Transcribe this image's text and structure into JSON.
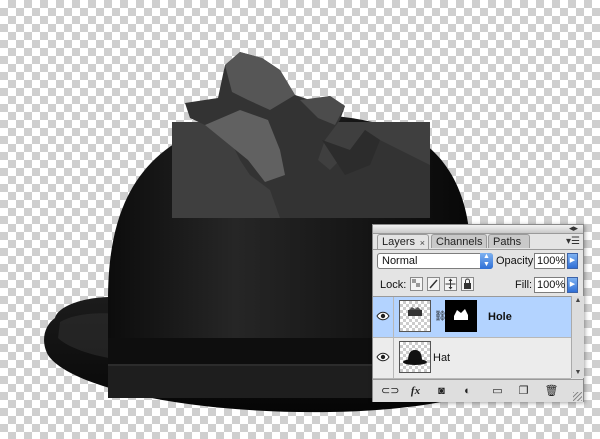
{
  "panel": {
    "tabs": [
      {
        "label": "Layers",
        "active": true
      },
      {
        "label": "Channels",
        "active": false
      },
      {
        "label": "Paths",
        "active": false
      }
    ],
    "tab_close": "×",
    "blend_mode": "Normal",
    "opacity_label": "Opacity:",
    "opacity_value": "100%",
    "lock_label": "Lock:",
    "fill_label": "Fill:",
    "fill_value": "100%",
    "layers": [
      {
        "name": "Hole",
        "selected": true,
        "visible": true,
        "has_mask": true
      },
      {
        "name": "Hat",
        "selected": false,
        "visible": true,
        "has_mask": false
      }
    ],
    "bottom_buttons": [
      "link-layers",
      "fx",
      "add-mask",
      "adjustment",
      "new-group",
      "new-layer",
      "delete-layer"
    ],
    "fx_label": "fx"
  },
  "colors": {
    "selection": "#b3d3ff",
    "aqua_blue": "#2f6fd6"
  }
}
